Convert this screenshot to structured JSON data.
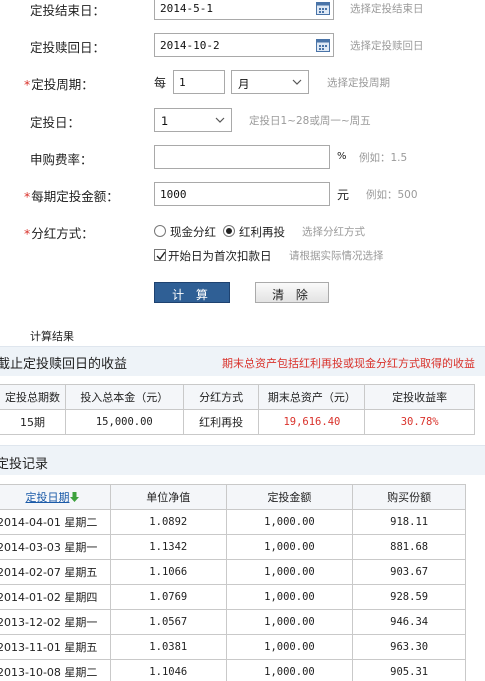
{
  "form": {
    "end_date": {
      "label": "定投结束日：",
      "value": "2014-5-1",
      "hint": "选择定投结束日"
    },
    "redeem_date": {
      "label": "定投赎回日：",
      "value": "2014-10-2",
      "hint": "选择定投赎回日"
    },
    "period": {
      "label": "定投周期：",
      "prefix": "每",
      "value": "1",
      "unit": "月",
      "hint": "选择定投周期"
    },
    "day": {
      "label": "定投日：",
      "value": "1",
      "hint": "定投日1~28或周一~周五"
    },
    "fee_rate": {
      "label": "申购费率：",
      "value": "",
      "unit": "%",
      "hint": "例如：1.5"
    },
    "amount": {
      "label": "每期定投金额：",
      "value": "1000",
      "unit": "元",
      "hint": "例如：500"
    },
    "dividend": {
      "label": "分红方式：",
      "option_cash": "现金分红",
      "option_reinvest": "红利再投",
      "hint": "选择分红方式"
    },
    "start_check": {
      "label": "开始日为首次扣款日",
      "hint": "请根据实际情况选择"
    },
    "required_mark": "*"
  },
  "buttons": {
    "calc": "计 算",
    "clear": "清 除"
  },
  "results": {
    "section_title": "计算结果",
    "summary_title": "截止定投赎回日的收益",
    "summary_note": "期末总资产包括红利再投或现金分红方式取得的收益",
    "summary_headers": [
      "定投总期数",
      "投入总本金（元）",
      "分红方式",
      "期末总资产（元）",
      "定投收益率"
    ],
    "summary_row": [
      "15期",
      "15,000.00",
      "红利再投",
      "19,616.40",
      "30.78%"
    ],
    "record_title": "定投记录",
    "record_headers": [
      "定投日期",
      "单位净值",
      "定投金额",
      "购买份额"
    ],
    "records": [
      [
        "2014-04-01 星期二",
        "1.0892",
        "1,000.00",
        "918.11"
      ],
      [
        "2014-03-03 星期一",
        "1.1342",
        "1,000.00",
        "881.68"
      ],
      [
        "2014-02-07 星期五",
        "1.1066",
        "1,000.00",
        "903.67"
      ],
      [
        "2014-01-02 星期四",
        "1.0769",
        "1,000.00",
        "928.59"
      ],
      [
        "2013-12-02 星期一",
        "1.0567",
        "1,000.00",
        "946.34"
      ],
      [
        "2013-11-01 星期五",
        "1.0381",
        "1,000.00",
        "963.30"
      ],
      [
        "2013-10-08 星期二",
        "1.1046",
        "1,000.00",
        "905.31"
      ]
    ]
  },
  "colors": {
    "accent": "#2f5f95",
    "warning": "#d9322b",
    "link": "#1a5aa8",
    "hint": "#9a9a9a"
  }
}
